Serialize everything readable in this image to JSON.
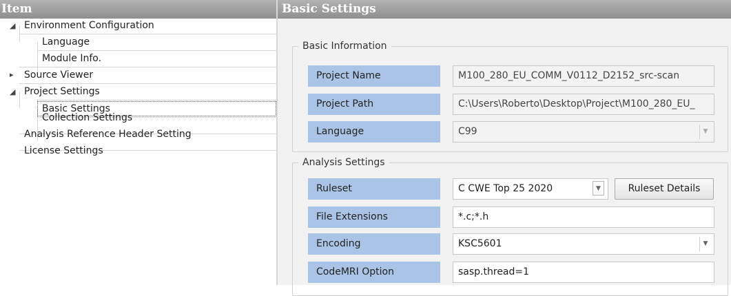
{
  "left_header": {
    "title": "Item"
  },
  "right_header": {
    "title": "Basic Settings"
  },
  "tree": {
    "environment": {
      "label": "Environment Configuration",
      "arrow": "◢"
    },
    "language": {
      "label": "Language"
    },
    "module_info": {
      "label": "Module Info."
    },
    "source_viewer": {
      "label": "Source Viewer",
      "arrow": "▸"
    },
    "project_settings": {
      "label": "Project Settings",
      "arrow": "◢"
    },
    "basic_settings": {
      "label": "Basic Settings"
    },
    "collection_settings": {
      "label": "Collection Settings"
    },
    "analysis_reference": {
      "label": "Analysis Reference Header Setting"
    },
    "license_settings": {
      "label": "License Settings"
    }
  },
  "basic_info": {
    "legend": "Basic Information",
    "project_name_label": "Project Name",
    "project_name_value": "M100_280_EU_COMM_V0112_D2152_src-scan",
    "project_path_label": "Project Path",
    "project_path_value": "C:\\Users\\Roberto\\Desktop\\Project\\M100_280_EU_",
    "language_label": "Language",
    "language_value": "C99"
  },
  "analysis": {
    "legend": "Analysis Settings",
    "ruleset_label": "Ruleset",
    "ruleset_value": "C CWE Top 25 2020",
    "ruleset_details_button": "Ruleset Details",
    "file_extensions_label": "File Extensions",
    "file_extensions_value": "*.c;*.h",
    "encoding_label": "Encoding",
    "encoding_value": "KSC5601",
    "codemri_label": "CodeMRI Option",
    "codemri_value": "sasp.thread=1"
  },
  "icons": {
    "dropdown": "triangle-down-icon"
  }
}
